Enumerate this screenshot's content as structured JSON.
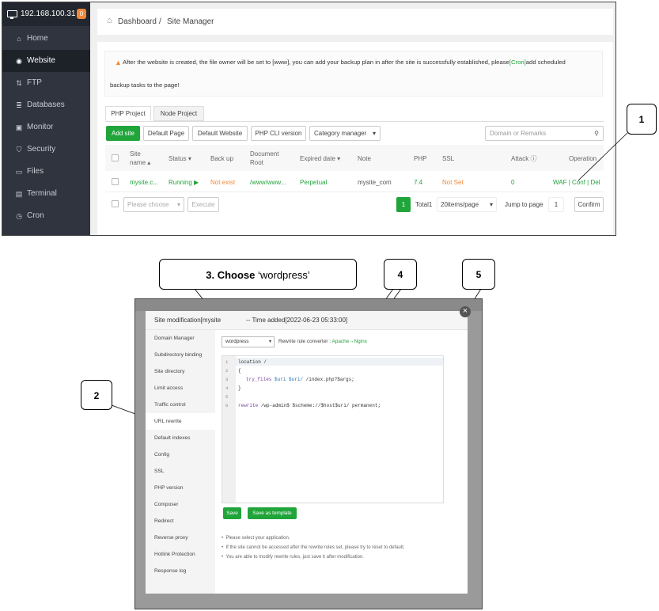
{
  "sidebar": {
    "host": "192.168.100.31",
    "badge": "0",
    "items": [
      {
        "label": "Home",
        "icon": "⌂"
      },
      {
        "label": "Website",
        "icon": "◉"
      },
      {
        "label": "FTP",
        "icon": "⇅"
      },
      {
        "label": "Databases",
        "icon": "≣"
      },
      {
        "label": "Monitor",
        "icon": "▣"
      },
      {
        "label": "Security",
        "icon": "⛉"
      },
      {
        "label": "Files",
        "icon": "▭"
      },
      {
        "label": "Terminal",
        "icon": "▤"
      },
      {
        "label": "Cron",
        "icon": "◷"
      }
    ]
  },
  "breadcrumb": {
    "home": "Dashboard",
    "sep": "/",
    "current": "Site Manager"
  },
  "notice": {
    "line1_a": "After the website is created, the file owner will be set to [www], you can add your backup plan in after the site is successfully established, please",
    "line1_link": "[Cron]",
    "line1_b": "add scheduled",
    "line2": "backup tasks to the page!"
  },
  "tabs": [
    "PHP Project",
    "Node Project"
  ],
  "toolbar": {
    "add_site": "Add site",
    "default_page": "Default Page",
    "default_website": "Default Website",
    "php_cli": "PHP CLI version",
    "category": "Category manager",
    "search_placeholder": "Domain or Remarks"
  },
  "table": {
    "headers": {
      "site_name": "Site name",
      "status": "Status",
      "backup": "Back up",
      "doc_root": "Document Root",
      "expired": "Expired date",
      "note": "Note",
      "php": "PHP",
      "ssl": "SSL",
      "attack": "Attack",
      "operation": "Operation"
    },
    "row": {
      "site_name": "mysite.c...",
      "status": "Running ▶",
      "backup": "Not exist",
      "doc_root": "/www/www...",
      "expired": "Perpetual",
      "note": "mysite_com",
      "php": "7.4",
      "ssl": "Not Set",
      "attack": "0",
      "op_waf": "WAF",
      "op_conf": "Conf",
      "op_del": "Del"
    }
  },
  "footer": {
    "choose_placeholder": "Please choose",
    "execute": "Execute",
    "page": "1",
    "total": "Total1",
    "per_page": "20items/page",
    "jump_label": "Jump to page",
    "jump_value": "1",
    "confirm": "Confirm"
  },
  "callouts": {
    "c1": "1",
    "c2": "2",
    "c3_bold": "3. Choose",
    "c3_rest": " ‘wordpress’",
    "c4": "4",
    "c5": "5"
  },
  "dialog": {
    "title_a": "Site modification[mysite",
    "title_b": "-- Time added[2022-06-23 05:33:00]",
    "menu": [
      "Domain Manager",
      "Subdirectory binding",
      "Site directory",
      "Limit access",
      "Traffic control",
      "URL rewrite",
      "Default indexes",
      "Config",
      "SSL",
      "PHP version",
      "Composer",
      "Redirect",
      "Reverse proxy",
      "Hotlink Protection",
      "Response log"
    ],
    "active_menu": "URL rewrite",
    "select_value": "wordpress",
    "converter_label": "Rewrite rule converter :",
    "converter_link": "Apache→Nginx",
    "code": {
      "line_numbers": [
        "1",
        "2",
        "3",
        "4",
        "5",
        "6"
      ],
      "l1": "location /",
      "l2": "{",
      "l3_kw": "try_files",
      "l3_var": "$uri $uri/",
      "l3_rest": " /index.php?$args;",
      "l4": "}",
      "l6_kw": "rewrite",
      "l6_rest": " /wp-admin$ $scheme://$host$uri/ permanent;"
    },
    "save": "Save",
    "save_template": "Save as template",
    "tips": [
      "Please select your application.",
      "If the site cannot be accessed after the rewrite rules set, please try to reset to default.",
      "You are able to modify rewrite rules, just save it after modification."
    ]
  },
  "colors": {
    "accent": "#20a53a",
    "warning": "#f0883a",
    "sidebar": "#2f343f"
  }
}
